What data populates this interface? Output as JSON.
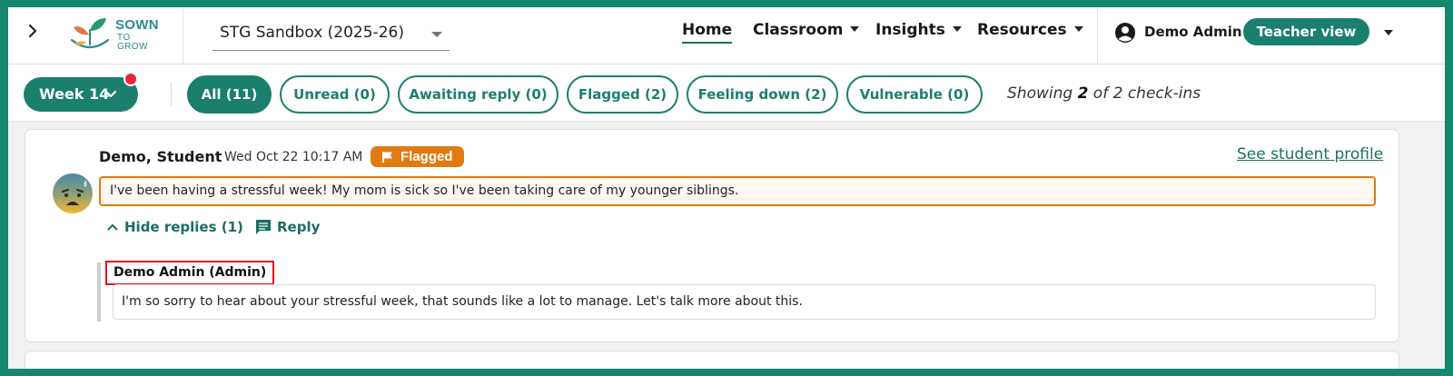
{
  "nav": {
    "brand_line1": "SOWN",
    "brand_line2": "TO GROW",
    "sandbox": "STG Sandbox (2025-26)",
    "links": {
      "home": "Home",
      "classroom": "Classroom",
      "insights": "Insights",
      "resources": "Resources"
    },
    "user_name": "Demo Admin",
    "teacher_view": "Teacher view"
  },
  "filters": {
    "week": "Week 14",
    "chips": {
      "all": "All (11)",
      "unread": "Unread (0)",
      "awaiting": "Awaiting reply (0)",
      "flagged": "Flagged (2)",
      "feeling_down": "Feeling down (2)",
      "vulnerable": "Vulnerable (0)"
    },
    "showing_prefix": "Showing ",
    "showing_count": "2",
    "showing_suffix": " of 2 check-ins"
  },
  "checkin": {
    "student_name": "Demo, Student",
    "date": "Wed Oct 22 10:17 AM",
    "badge": "Flagged",
    "profile_link": "See student profile",
    "message": "I've been having a stressful week! My mom is sick so I've been taking care of my younger siblings.",
    "hide_replies": "Hide replies (1)",
    "reply": "Reply",
    "reply_author": "Demo Admin (Admin)",
    "reply_text": "I'm so sorry to hear about your stressful week, that sounds like a lot to manage. Let's talk more about this."
  },
  "colors": {
    "brand_green": "#1a7f6d",
    "flag_orange": "#e07b12",
    "notif_red": "#e8283f",
    "highlight_red": "#e0141a"
  },
  "icons": [
    "chevron-right-icon",
    "sown-to-grow-logo",
    "chevron-down-icon",
    "user-circle-icon",
    "flag-icon",
    "sad-face-avatar",
    "chevron-up-icon",
    "chat-bubble-icon"
  ]
}
